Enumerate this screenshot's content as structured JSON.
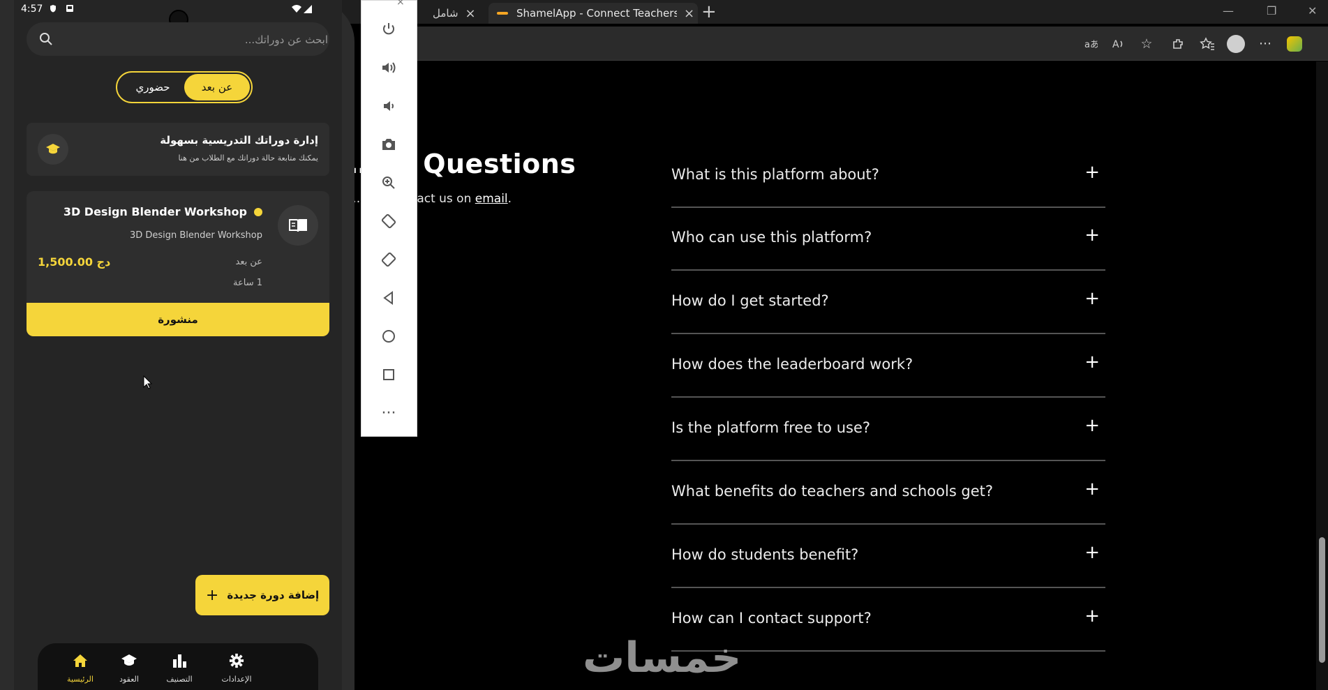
{
  "browser": {
    "tabs": [
      {
        "label": "شامل"
      },
      {
        "label": "ShamelApp - Connect Teachers, S"
      }
    ],
    "new_tab": "+",
    "window_controls": [
      "—",
      "❐",
      "✕"
    ],
    "toolbar_icons": [
      "translate-icon",
      "read-aloud-icon",
      "favorite-icon",
      "extensions-icon",
      "favorites-icon",
      "profile-icon",
      "more-icon",
      "copilot-icon"
    ]
  },
  "faq": {
    "title": "…ed Questions",
    "subtitle_prefix": "…on? Contact us on ",
    "subtitle_link": "email",
    "subtitle_suffix": ".",
    "items": [
      {
        "question": "What is this platform about?"
      },
      {
        "question": "Who can use this platform?"
      },
      {
        "question": "How do I get started?"
      },
      {
        "question": "How does the leaderboard work?"
      },
      {
        "question": "Is the platform free to use?"
      },
      {
        "question": "What benefits do teachers and schools get?"
      },
      {
        "question": "How do students benefit?"
      },
      {
        "question": "How can I contact support?"
      }
    ],
    "expand_symbol": "+"
  },
  "watermark": "خمسات",
  "emulator_toolbar": {
    "close": "×",
    "buttons": [
      "power-icon",
      "volume-up-icon",
      "volume-down-icon",
      "camera-icon",
      "zoom-icon",
      "rotate-left-icon",
      "rotate-right-icon",
      "back-icon",
      "home-icon",
      "overview-icon",
      "more-icon"
    ]
  },
  "phone": {
    "status": {
      "time": "4:57"
    },
    "search": {
      "placeholder": "ابحث عن دوراتك..."
    },
    "mode_toggle": {
      "remote": "عن بعد",
      "onsite": "حضوري",
      "selected": "remote"
    },
    "info_card": {
      "title": "إدارة دوراتك التدريسية بسهولة",
      "subtitle": "يمكنك متابعة حالة دوراتك مع الطلاب من هنا"
    },
    "course": {
      "title": "3D Design Blender Workshop",
      "subtitle": "3D Design Blender Workshop",
      "price": "1,500.00 دج",
      "mode": "عن بعد",
      "duration": "1 ساعة",
      "status": "منشورة"
    },
    "add_button": {
      "label": "إضافة دورة جديدة",
      "icon": "+"
    },
    "bottom_nav": [
      {
        "label": "الرئيسية",
        "icon": "home-icon",
        "active": true
      },
      {
        "label": "العقود",
        "icon": "graduation-cap-icon",
        "active": false
      },
      {
        "label": "التصنيف",
        "icon": "bar-chart-icon",
        "active": false
      },
      {
        "label": "الإعدادات",
        "icon": "gear-icon",
        "active": false
      }
    ],
    "accent": "#f5d53a"
  }
}
